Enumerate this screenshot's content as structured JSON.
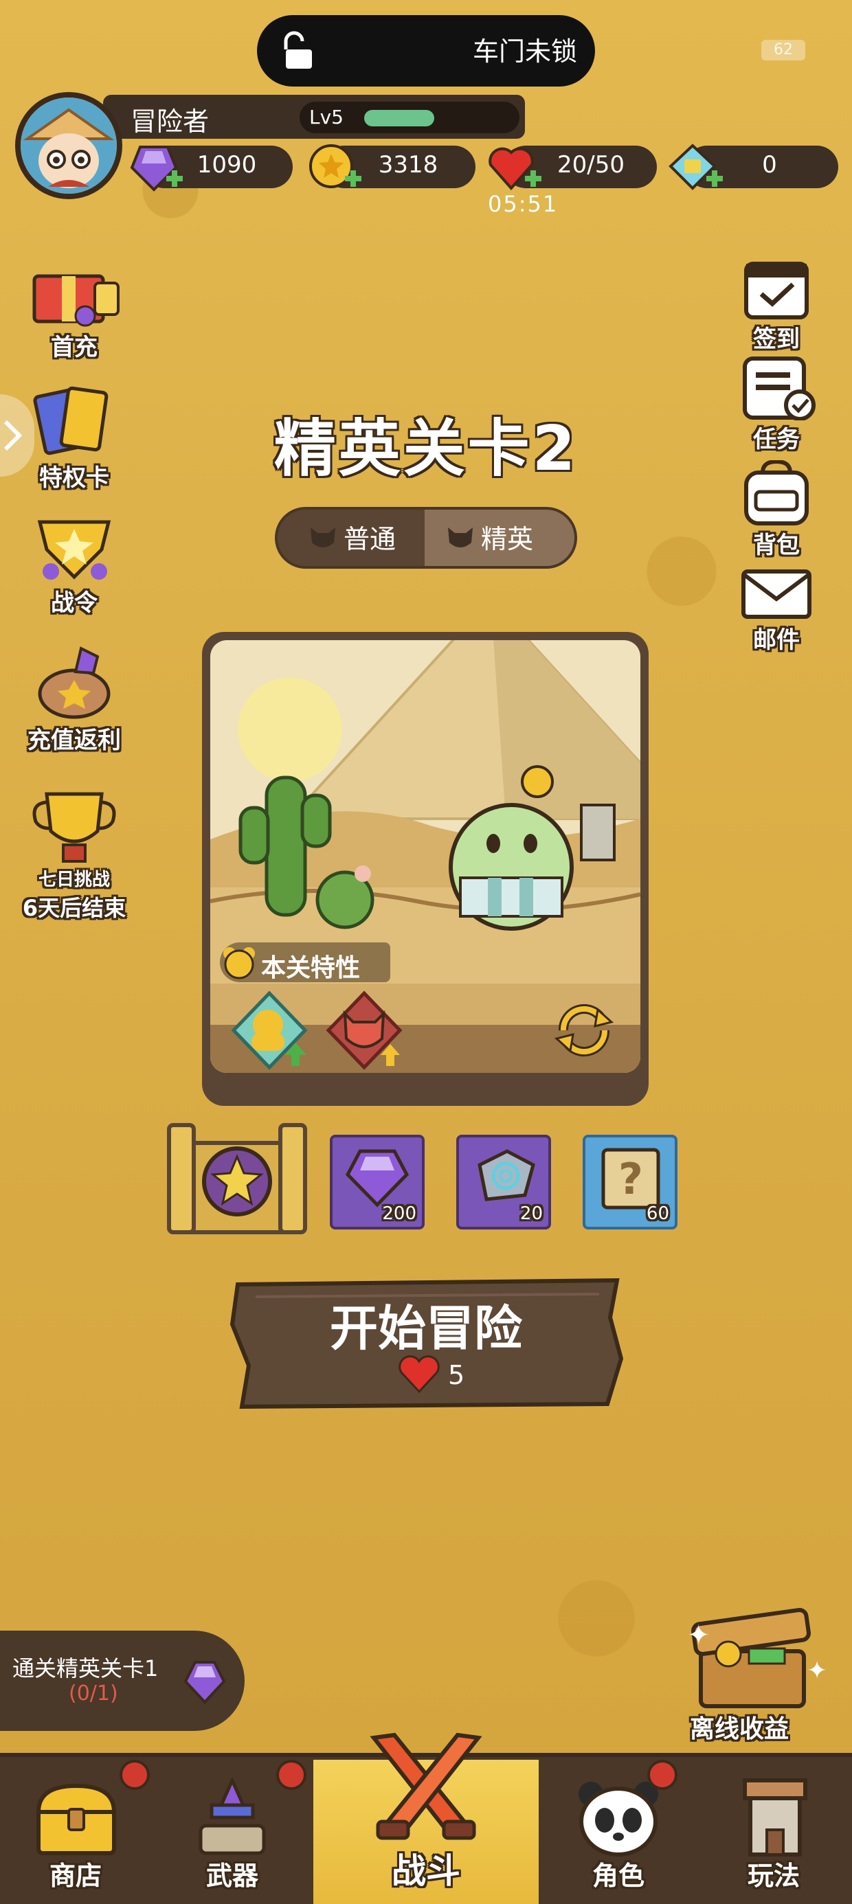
{
  "status_bar": {
    "door_text": "车门未锁",
    "battery": "62"
  },
  "player": {
    "name": "冒险者",
    "level": "Lv5",
    "level_progress": 0.35
  },
  "resources": [
    {
      "icon": "gem-icon",
      "value": "1090"
    },
    {
      "icon": "coin-icon",
      "value": "3318"
    },
    {
      "icon": "heart-icon",
      "value": "20/50"
    },
    {
      "icon": "ticket-icon",
      "value": "0"
    }
  ],
  "energy_timer": "05:51",
  "left_menu": [
    {
      "label": "首充"
    },
    {
      "label": "特权卡"
    },
    {
      "label": "战令"
    },
    {
      "label": "充值返利"
    },
    {
      "label": "七日挑战",
      "sub": "6天后结束"
    }
  ],
  "right_menu": [
    {
      "label": "签到"
    },
    {
      "label": "任务"
    },
    {
      "label": "背包"
    },
    {
      "label": "邮件"
    }
  ],
  "stage": {
    "title": "精英关卡2",
    "modes": [
      "普通",
      "精英"
    ],
    "selected_mode": "精英",
    "trait_label": "本关特性"
  },
  "rewards": [
    {
      "icon": "gem-icon",
      "count": "200"
    },
    {
      "icon": "stone-icon",
      "count": "20"
    },
    {
      "icon": "mystery-scroll-icon",
      "count": "60"
    }
  ],
  "start": {
    "label": "开始冒险",
    "cost": "5"
  },
  "quest": {
    "title": "通关精英关卡1",
    "progress": "(0/1)"
  },
  "offline": {
    "label": "离线收益"
  },
  "nav": [
    {
      "label": "商店",
      "badge": true
    },
    {
      "label": "武器",
      "badge": true
    },
    {
      "label": "战斗",
      "badge": false,
      "active": true
    },
    {
      "label": "角色",
      "badge": true
    },
    {
      "label": "玩法",
      "badge": false
    }
  ],
  "colors": {
    "background": "#dcb14c",
    "panel": "#3d2f24",
    "accent_green": "#6cc48c",
    "badge_red": "#d23a30",
    "nav_active": "#f4d25a"
  }
}
